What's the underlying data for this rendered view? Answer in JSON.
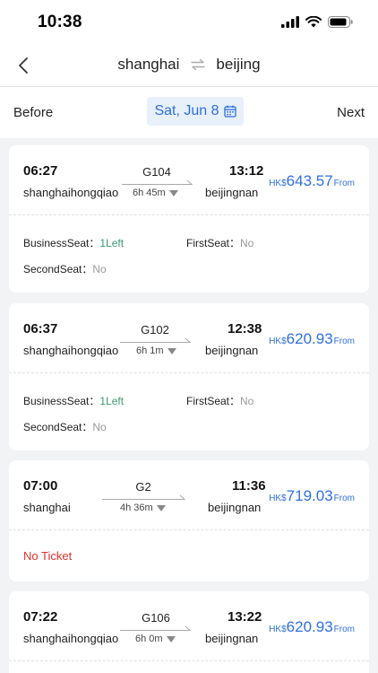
{
  "status": {
    "time": "10:38"
  },
  "nav": {
    "from": "shanghai",
    "to": "beijing"
  },
  "date_bar": {
    "prev": "Before",
    "date": "Sat, Jun 8",
    "next": "Next"
  },
  "labels": {
    "currency": "HK$",
    "from": "From",
    "business": "BusinessSeat：",
    "first": "FirstSeat：",
    "second": "SecondSeat："
  },
  "trains": [
    {
      "dep_time": "06:27",
      "dep_station": "shanghaihongqiao",
      "train_no": "G104",
      "duration": "6h 45m",
      "arr_time": "13:12",
      "arr_station": "beijingnan",
      "price": "643.57",
      "business": "1Left",
      "first": "No",
      "second": "No"
    },
    {
      "dep_time": "06:37",
      "dep_station": "shanghaihongqiao",
      "train_no": "G102",
      "duration": "6h 1m",
      "arr_time": "12:38",
      "arr_station": "beijingnan",
      "price": "620.93",
      "business": "1Left",
      "first": "No",
      "second": "No"
    },
    {
      "dep_time": "07:00",
      "dep_station": "shanghai",
      "train_no": "G2",
      "duration": "4h 36m",
      "arr_time": "11:36",
      "arr_station": "beijingnan",
      "price": "719.03",
      "no_ticket": "No Ticket"
    },
    {
      "dep_time": "07:22",
      "dep_station": "shanghaihongqiao",
      "train_no": "G106",
      "duration": "6h 0m",
      "arr_time": "13:22",
      "arr_station": "beijingnan",
      "price": "620.93"
    }
  ]
}
